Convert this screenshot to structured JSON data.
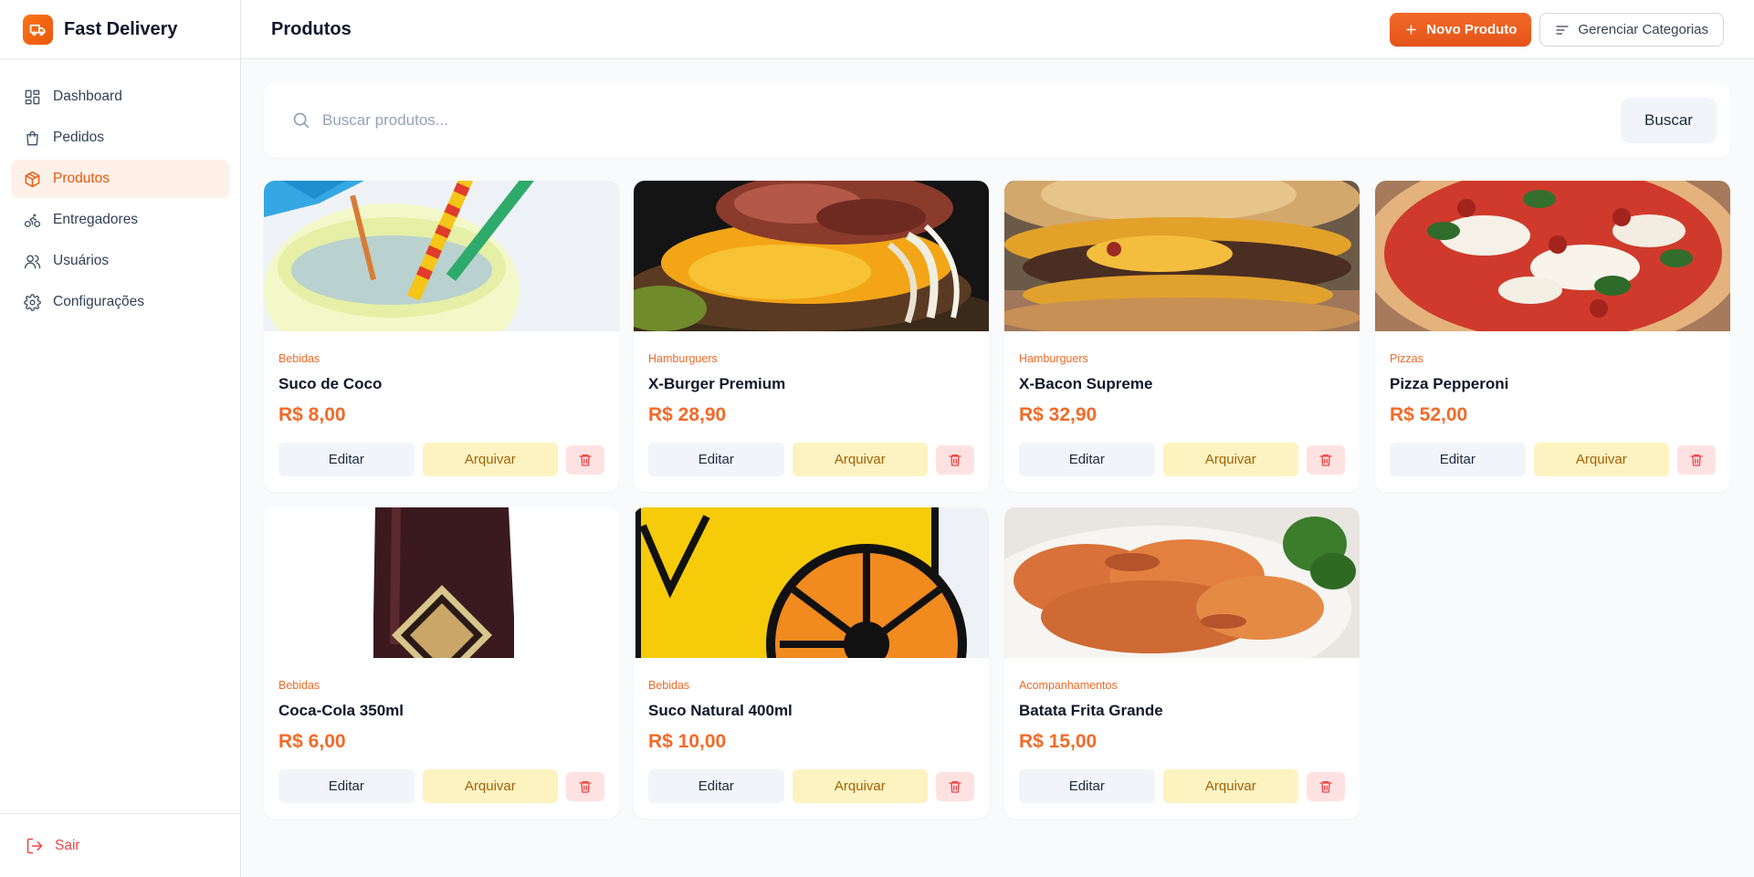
{
  "app": {
    "name": "Fast Delivery"
  },
  "sidebar": {
    "items": [
      {
        "label": "Dashboard",
        "icon": "dashboard-icon",
        "active": false
      },
      {
        "label": "Pedidos",
        "icon": "shopping-bag-icon",
        "active": false
      },
      {
        "label": "Produtos",
        "icon": "package-icon",
        "active": true
      },
      {
        "label": "Entregadores",
        "icon": "bike-icon",
        "active": false
      },
      {
        "label": "Usuários",
        "icon": "users-icon",
        "active": false
      },
      {
        "label": "Configurações",
        "icon": "gear-icon",
        "active": false
      }
    ],
    "logout_label": "Sair"
  },
  "header": {
    "title": "Produtos",
    "new_product_label": "Novo Produto",
    "manage_categories_label": "Gerenciar Categorias"
  },
  "search": {
    "placeholder": "Buscar produtos...",
    "value": "",
    "button_label": "Buscar"
  },
  "product_actions": {
    "edit_label": "Editar",
    "archive_label": "Arquivar"
  },
  "products": [
    {
      "category": "Bebidas",
      "name": "Suco de Coco",
      "price": "R$ 8,00",
      "image": "coconut-juice-illustration"
    },
    {
      "category": "Hamburguers",
      "name": "X-Burger Premium",
      "price": "R$ 28,90",
      "image": "bacon-burger-photo"
    },
    {
      "category": "Hamburguers",
      "name": "X-Bacon Supreme",
      "price": "R$ 32,90",
      "image": "double-burger-photo"
    },
    {
      "category": "Pizzas",
      "name": "Pizza Pepperoni",
      "price": "R$ 52,00",
      "image": "pizza-photo"
    },
    {
      "category": "Bebidas",
      "name": "Coca-Cola 350ml",
      "price": "R$ 6,00",
      "image": "cola-bottle-photo"
    },
    {
      "category": "Bebidas",
      "name": "Suco Natural 400ml",
      "price": "R$ 10,00",
      "image": "orange-juice-illustration"
    },
    {
      "category": "Acompanhamentos",
      "name": "Batata Frita Grande",
      "price": "R$ 15,00",
      "image": "sweet-potato-fries-photo"
    }
  ],
  "colors": {
    "accent": "#f26a28",
    "active_nav_bg": "#fff1e8",
    "danger": "#ef4444",
    "archive_bg": "#fdf3c1",
    "archive_text": "#a16207"
  }
}
